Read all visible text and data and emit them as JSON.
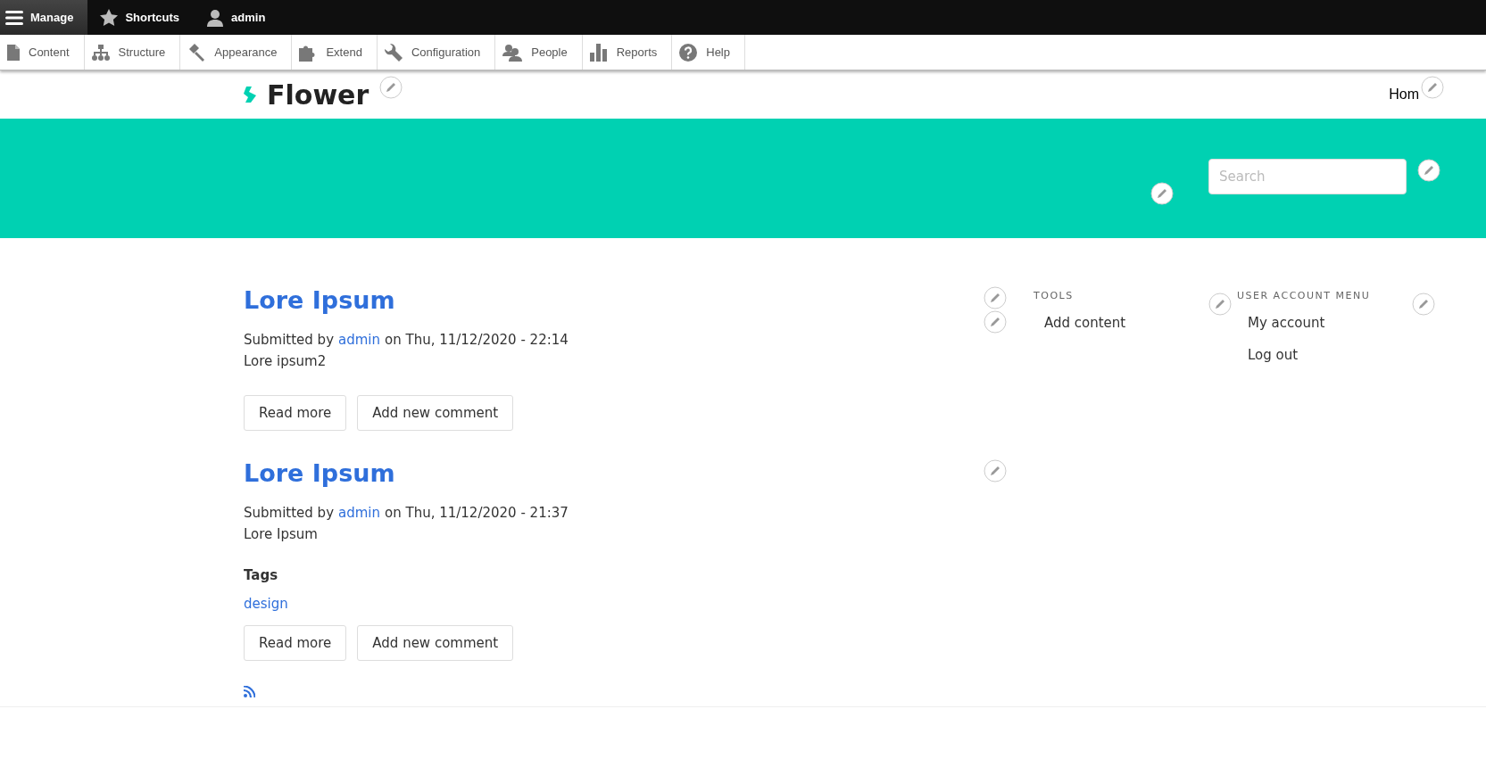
{
  "toolbar": {
    "tabs": [
      {
        "label": "Manage",
        "selected": true
      },
      {
        "label": "Shortcuts",
        "selected": false
      },
      {
        "label": "admin",
        "selected": false
      }
    ],
    "menu": [
      "Content",
      "Structure",
      "Appearance",
      "Extend",
      "Configuration",
      "People",
      "Reports",
      "Help"
    ]
  },
  "header": {
    "site_name": "Flower",
    "nav": [
      "Hom"
    ]
  },
  "search": {
    "placeholder": "Search"
  },
  "articles": [
    {
      "title": "Lore Ipsum",
      "submitted_prefix": "Submitted by",
      "author": "admin",
      "submitted_suffix": "on Thu, 11/12/2020 - 22:14",
      "body": "Lore ipsum2",
      "buttons": [
        "Read more",
        "Add new comment"
      ]
    },
    {
      "title": "Lore Ipsum",
      "submitted_prefix": "Submitted by",
      "author": "admin",
      "submitted_suffix": "on Thu, 11/12/2020 - 21:37",
      "body": "Lore Ipsum",
      "tags_label": "Tags",
      "tags": [
        "design"
      ],
      "buttons": [
        "Read more",
        "Add new comment"
      ]
    }
  ],
  "blocks": [
    {
      "title": "TOOLS",
      "links": [
        "Add content"
      ]
    },
    {
      "title": "USER ACCOUNT MENU",
      "links": [
        "My account",
        "Log out"
      ]
    }
  ]
}
